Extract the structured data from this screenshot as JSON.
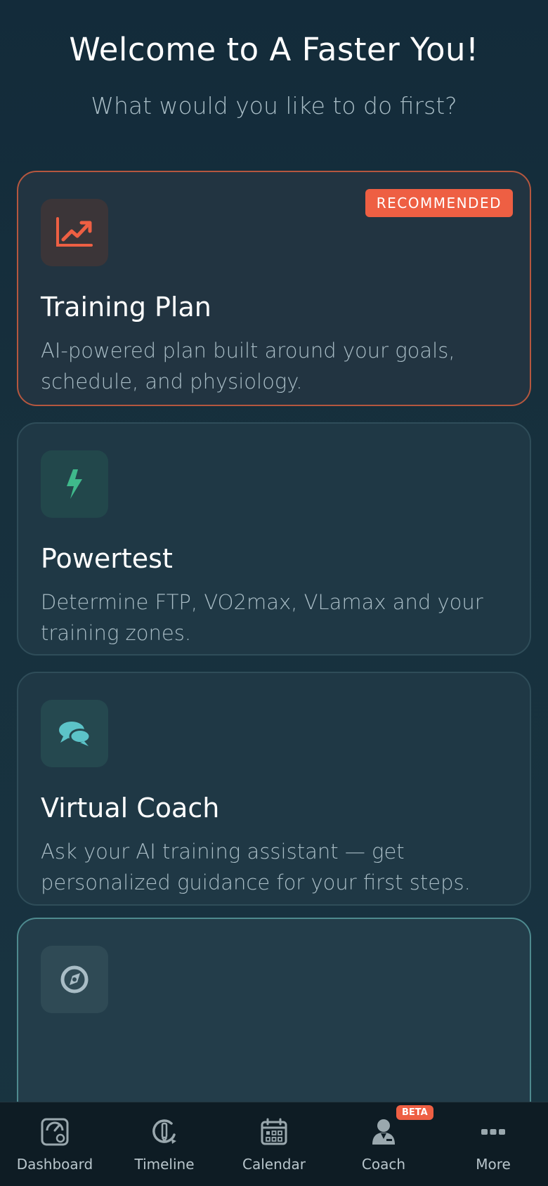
{
  "header": {
    "title": "Welcome to A Faster You!",
    "subtitle": "What would you like to do first?"
  },
  "cards": [
    {
      "title": "Training Plan",
      "description": "AI-powered plan built around your goals, schedule, and physiology.",
      "badge": "RECOMMENDED",
      "icon": "chart-trend-icon",
      "accent": "#ee5f43"
    },
    {
      "title": "Powertest",
      "description": "Determine FTP, VO2max, VLamax and your training zones.",
      "icon": "bolt-icon",
      "accent": "#3fb98b"
    },
    {
      "title": "Virtual Coach",
      "description": "Ask your AI training assistant — get personalized guidance for your first steps.",
      "icon": "chat-bubbles-icon",
      "accent": "#5cc3c8"
    },
    {
      "icon": "compass-icon",
      "accent": "#a9bdc6"
    }
  ],
  "tabbar": {
    "items": [
      {
        "label": "Dashboard",
        "icon": "dashboard-gauge-icon"
      },
      {
        "label": "Timeline",
        "icon": "timeline-icon"
      },
      {
        "label": "Calendar",
        "icon": "calendar-icon"
      },
      {
        "label": "Coach",
        "icon": "coach-person-icon",
        "badge": "BETA"
      },
      {
        "label": "More",
        "icon": "more-dots-icon"
      }
    ]
  },
  "colors": {
    "background": "#132b3a",
    "accent": "#ee5f43",
    "muted_text": "#a9bdc6"
  }
}
